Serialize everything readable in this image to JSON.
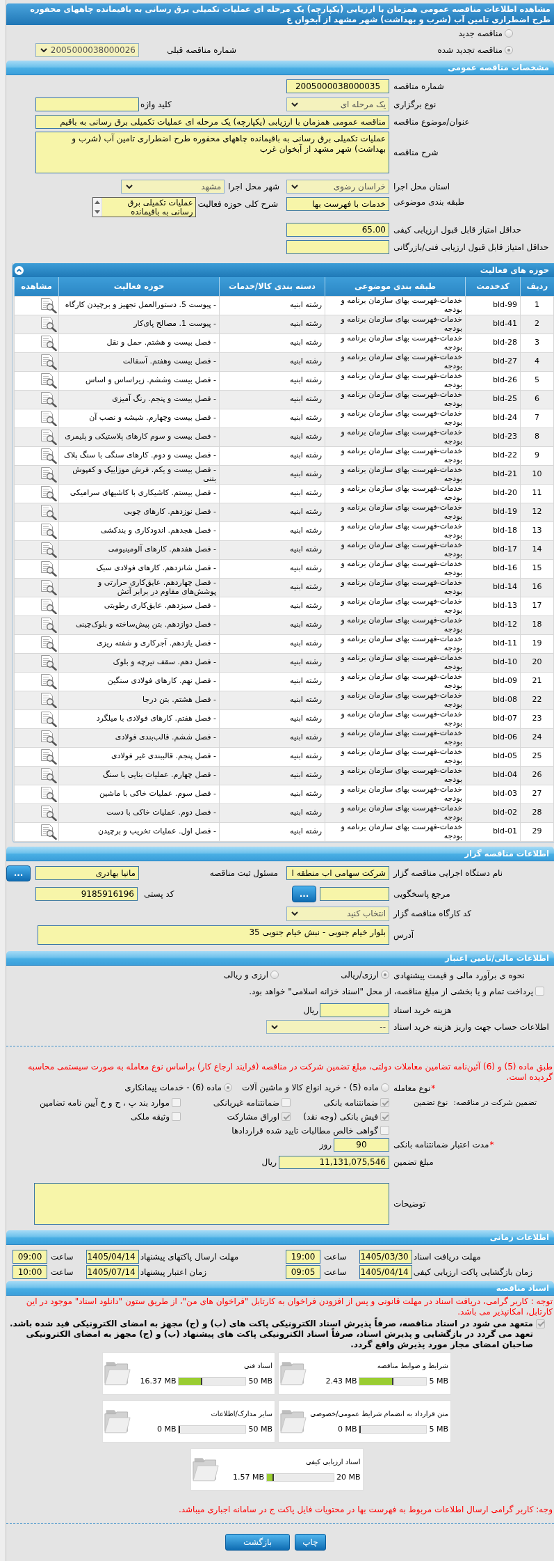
{
  "title": "مشاهده اطلاعات مناقصه عمومی همزمان با ارزیابی (یکپارچه) یک مرحله ای عملیات تکمیلی برق رسانی به باقیمانده چاههای محفوره طرح اضطراری تامین آب (شرب و بهداشت) شهر مشهد از آبخوان غ",
  "tender_kind": {
    "options": [
      {
        "label": "مناقصه جدید",
        "selected": false
      },
      {
        "label": "مناقصه تجدید شده",
        "selected": true
      }
    ],
    "previous_number": {
      "label": "شماره مناقصه قبلی",
      "value": "2005000038000026"
    }
  },
  "general": {
    "title": "مشخصات مناقصه عمومی",
    "tender_number": {
      "label": "شماره مناقصه",
      "value": "2005000038000035"
    },
    "holding_type": {
      "label": "نوع برگزاری",
      "value": "یک مرحله ای"
    },
    "keyword": {
      "label": "کلید واژه"
    },
    "subject": {
      "label": "عنوان/موضوع مناقصه",
      "value": "مناقصه عمومی همزمان با ارزیابی (یکپارچه) یک مرحله ای عملیات تکمیلی برق رسانی به باقیم"
    },
    "description": {
      "label": "شرح مناقصه",
      "value": "عملیات تکمیلی برق رسانی به باقیمانده چاههای محفوره طرح اضطراری تامین آب (شرب و بهداشت) شهر مشهد از آبخوان غرب"
    },
    "province": {
      "label": "استان محل اجرا",
      "value": "خراسان رضوی"
    },
    "city": {
      "label": "شهر محل اجرا",
      "value": "مشهد"
    },
    "classification": {
      "label": "طبقه بندی موضوعی",
      "value": "خدمات با فهرست بها"
    },
    "activity_summary": {
      "label": "شرح کلی حوزه فعالیت",
      "value": "عملیات تکمیلی برق رسانی به باقیمانده"
    },
    "min_quality_score": {
      "label": "حداقل امتیاز قابل قبول ارزیابی کیفی",
      "value": "65.00"
    },
    "min_technical_score": {
      "label": "حداقل امتیاز قابل قبول ارزیابی فنی/بازرگانی"
    }
  },
  "activities": {
    "title": "حوزه های فعالیت",
    "columns": [
      "ردیف",
      "کدخدمت",
      "طبقه بندی موضوعی",
      "دسته بندی کالا/خدمات",
      "حوزه فعالیت",
      "مشاهده"
    ],
    "rows": [
      {
        "row": "1",
        "code": "bld-99",
        "classification": "خدمات-فهرست بهای سازمان برنامه و بودجه",
        "category": "رشته ابنیه",
        "activity": "- پیوست 5. دستورالعمل تجهیز و برچیدن کارگاه"
      },
      {
        "row": "2",
        "code": "bld-41",
        "classification": "خدمات-فهرست بهای سازمان برنامه و بودجه",
        "category": "رشته ابنیه",
        "activity": "- پیوست 1. مصالح پای‌کار"
      },
      {
        "row": "3",
        "code": "bld-28",
        "classification": "خدمات-فهرست بهای سازمان برنامه و بودجه",
        "category": "رشته ابنیه",
        "activity": "- فصل بیست و هشتم. حمل و نقل"
      },
      {
        "row": "4",
        "code": "bld-27",
        "classification": "خدمات-فهرست بهای سازمان برنامه و بودجه",
        "category": "رشته ابنیه",
        "activity": "- فصل بیست وهفتم. آسفالت"
      },
      {
        "row": "5",
        "code": "bld-26",
        "classification": "خدمات-فهرست بهای سازمان برنامه و بودجه",
        "category": "رشته ابنیه",
        "activity": "- فصل بیست وششم. زیراساس و اساس"
      },
      {
        "row": "6",
        "code": "bld-25",
        "classification": "خدمات-فهرست بهای سازمان برنامه و بودجه",
        "category": "رشته ابنیه",
        "activity": "- فصل بیست و پنجم. رنگ آمیزی"
      },
      {
        "row": "7",
        "code": "bld-24",
        "classification": "خدمات-فهرست بهای سازمان برنامه و بودجه",
        "category": "رشته ابنیه",
        "activity": "- فصل بیست وچهارم. شیشه و نصب آن"
      },
      {
        "row": "8",
        "code": "bld-23",
        "classification": "خدمات-فهرست بهای سازمان برنامه و بودجه",
        "category": "رشته ابنیه",
        "activity": "- فصل بیست و سوم کارهای پلاستیکی و پلیمری"
      },
      {
        "row": "9",
        "code": "bld-22",
        "classification": "خدمات-فهرست بهای سازمان برنامه و بودجه",
        "category": "رشته ابنیه",
        "activity": "- فصل بیست و دوم. کارهای سنگی با سنگ پلاک"
      },
      {
        "row": "10",
        "code": "bld-21",
        "classification": "خدمات-فهرست بهای سازمان برنامه و بودجه",
        "category": "رشته ابنیه",
        "activity": "- فصل بیست و یکم. فرش موزاییک و کفپوش بتنی"
      },
      {
        "row": "11",
        "code": "bld-20",
        "classification": "خدمات-فهرست بهای سازمان برنامه و بودجه",
        "category": "رشته ابنیه",
        "activity": "- فصل بیستم. کاشیکاری با کاشیهای سرامیکی"
      },
      {
        "row": "12",
        "code": "bld-19",
        "classification": "خدمات-فهرست بهای سازمان برنامه و بودجه",
        "category": "رشته ابنیه",
        "activity": "- فصل نوزدهم. کارهای چوبی"
      },
      {
        "row": "13",
        "code": "bld-18",
        "classification": "خدمات-فهرست بهای سازمان برنامه و بودجه",
        "category": "رشته ابنیه",
        "activity": "- فصل هجدهم. اندودکاری و بندکشی"
      },
      {
        "row": "14",
        "code": "bld-17",
        "classification": "خدمات-فهرست بهای سازمان برنامه و بودجه",
        "category": "رشته ابنیه",
        "activity": "- فصل هفدهم. کارهای آلومینیومی"
      },
      {
        "row": "15",
        "code": "bld-16",
        "classification": "خدمات-فهرست بهای سازمان برنامه و بودجه",
        "category": "رشته ابنیه",
        "activity": "- فصل شانزدهم. کارهای فولادی سبک"
      },
      {
        "row": "16",
        "code": "bld-14",
        "classification": "خدمات-فهرست بهای سازمان برنامه و بودجه",
        "category": "رشته ابنیه",
        "activity": "- فصل چهاردهم. عایق‌کاری حرارتی و پوشش‌های مقاوم در برابر آتش"
      },
      {
        "row": "17",
        "code": "bld-13",
        "classification": "خدمات-فهرست بهای سازمان برنامه و بودجه",
        "category": "رشته ابنیه",
        "activity": "- فصل سیزدهم. عایق‌کاری رطوبتی"
      },
      {
        "row": "18",
        "code": "bld-12",
        "classification": "خدمات-فهرست بهای سازمان برنامه و بودجه",
        "category": "رشته ابنیه",
        "activity": "- فصل دوازدهم. بتن پیش‌ساخته و بلوک‌چینی"
      },
      {
        "row": "19",
        "code": "bld-11",
        "classification": "خدمات-فهرست بهای سازمان برنامه و بودجه",
        "category": "رشته ابنیه",
        "activity": "- فصل یازدهم. آجرکاری و شفته ریزی"
      },
      {
        "row": "20",
        "code": "bld-10",
        "classification": "خدمات-فهرست بهای سازمان برنامه و بودجه",
        "category": "رشته ابنیه",
        "activity": "- فصل دهم. سقف تیرچه و بلوک"
      },
      {
        "row": "21",
        "code": "bld-09",
        "classification": "خدمات-فهرست بهای سازمان برنامه و بودجه",
        "category": "رشته ابنیه",
        "activity": "- فصل نهم. کارهای فولادی سنگین"
      },
      {
        "row": "22",
        "code": "bld-08",
        "classification": "خدمات-فهرست بهای سازمان برنامه و بودجه",
        "category": "رشته ابنیه",
        "activity": "- فصل هشتم. بتن درجا"
      },
      {
        "row": "23",
        "code": "bld-07",
        "classification": "خدمات-فهرست بهای سازمان برنامه و بودجه",
        "category": "رشته ابنیه",
        "activity": "- فصل هفتم. کارهای فولادی با میلگرد"
      },
      {
        "row": "24",
        "code": "bld-06",
        "classification": "خدمات-فهرست بهای سازمان برنامه و بودجه",
        "category": "رشته ابنیه",
        "activity": "- فصل ششم. قالب‌بندی فولادی"
      },
      {
        "row": "25",
        "code": "bld-05",
        "classification": "خدمات-فهرست بهای سازمان برنامه و بودجه",
        "category": "رشته ابنیه",
        "activity": "- فصل پنجم. قالببندی غیر فولادی"
      },
      {
        "row": "26",
        "code": "bld-04",
        "classification": "خدمات-فهرست بهای سازمان برنامه و بودجه",
        "category": "رشته ابنیه",
        "activity": "- فصل چهارم. عملیات بنایی با سنگ"
      },
      {
        "row": "27",
        "code": "bld-03",
        "classification": "خدمات-فهرست بهای سازمان برنامه و بودجه",
        "category": "رشته ابنیه",
        "activity": "- فصل سوم. عملیات خاکی با ماشین"
      },
      {
        "row": "28",
        "code": "bld-02",
        "classification": "خدمات-فهرست بهای سازمان برنامه و بودجه",
        "category": "رشته ابنیه",
        "activity": "- فصل دوم. عملیات خاکی با دست"
      },
      {
        "row": "29",
        "code": "bld-01",
        "classification": "خدمات-فهرست بهای سازمان برنامه و بودجه",
        "category": "رشته ابنیه",
        "activity": "- فصل اول. عملیات تخریب و برچیدن"
      }
    ]
  },
  "organizer": {
    "title": "اطلاعات مناقصه گزار",
    "agency": {
      "label": "نام دستگاه اجرایی مناقصه گزار",
      "value": "شرکت سهامی اب منطقه ا"
    },
    "registrar": {
      "label": "مسئول ثبت مناقصه",
      "value": "مانیا بهادری",
      "button": "..."
    },
    "reference": {
      "label": "مرجع پاسخگویی",
      "button": "..."
    },
    "postal_code": {
      "label": "کد پستی",
      "value": "9185916196"
    },
    "workshop_code": {
      "label": "کد کارگاه مناقصه گزار",
      "value": "انتخاب کنید"
    },
    "address": {
      "label": "آدرس",
      "value": "بلوار خیام جنوبی - نبش خیام جنوبی 35"
    }
  },
  "finance": {
    "title": "اطلاعات مالی/تامین اعتبار",
    "estimate": {
      "label": "نحوه ی برآورد مالی و قیمت پیشنهادی",
      "options": [
        {
          "label": "ارزی/ریالی",
          "selected": true
        },
        {
          "label": "ارزی و ریالی",
          "selected": false
        }
      ]
    },
    "treasury": {
      "label": "پرداخت تمام و یا بخشی از مبلغ مناقصه، از محل \"اسناد خزانه اسلامی\" خواهد بود.",
      "checked": false
    },
    "document_fee": {
      "label": "هزینه خرید اسناد",
      "unit": "ریال"
    },
    "account": {
      "label": "اطلاعات حساب جهت واریز هزینه خرید اسناد",
      "value": "--"
    }
  },
  "guarantee": {
    "notice": "طبق ماده (5) و (6) آئین‌نامه تضامین معاملات دولتی، مبلغ تضمین شرکت در مناقصه (فرایند ارجاع کار) براساس نوع معامله به صورت سیستمی محاسبه گردیده است.",
    "deal_type": {
      "mark": "*",
      "label": "نوع معامله",
      "options": [
        {
          "label": "ماده (5) - خرید انواع کالا و ماشین آلات",
          "selected": false
        },
        {
          "label": "ماده (6) - خدمات پیمانکاری",
          "selected": true
        }
      ]
    },
    "participation_label": "تضمین شرکت در مناقصه:",
    "type_label": "نوع تضمین",
    "types": [
      {
        "label": "ضمانتنامه بانکی",
        "checked": true
      },
      {
        "label": "ضمانتنامه غیربانکی",
        "checked": false
      },
      {
        "label": "موارد بند پ ، ح و خ آیین نامه تضامین",
        "checked": false
      },
      {
        "label": "فیش بانکی (وجه نقد)",
        "checked": true
      },
      {
        "label": "اوراق مشارکت",
        "checked": true
      },
      {
        "label": "وثیقه ملکی",
        "checked": false
      },
      {
        "label": "گواهی خالص مطالبات تایید شده قراردادها",
        "checked": false
      }
    ],
    "validity": {
      "mark": "*",
      "label": "مدت اعتبار ضمانتنامه بانکی",
      "value": "90",
      "unit": "روز"
    },
    "amount": {
      "label": "مبلغ تضمین",
      "value": "11,131,075,546",
      "unit": "ریال"
    },
    "notes": {
      "label": "توضیحات"
    }
  },
  "schedule": {
    "title": "اطلاعات زمانی",
    "items": [
      {
        "label": "مهلت دریافت اسناد",
        "date": "1405/03/30",
        "time_label": "ساعت",
        "time": "19:00"
      },
      {
        "label": "مهلت ارسال پاکتهای پیشنهاد",
        "date": "1405/04/14",
        "time_label": "ساعت",
        "time": "09:00"
      },
      {
        "label": "زمان بازگشایی پاکت ارزیابی کیفی",
        "date": "1405/04/14",
        "time_label": "ساعت",
        "time": "09:05"
      },
      {
        "label": "زمان اعتبار پیشنهاد",
        "date": "1405/07/14",
        "time_label": "ساعت",
        "time": "10:00"
      }
    ]
  },
  "documents": {
    "title": "اسناد مناقصه",
    "notice": "توجه : کاربر گرامی، دریافت اسناد در مهلت قانونی و پس از افزودن فراخوان به کارتابل \"فراخوان های من\"، از طریق ستون \"دانلود اسناد\" موجود در این کارتابل، امکانپذیر می باشد.",
    "commitment": {
      "checked": true,
      "text": "متعهد می شود در اسناد مناقصه، صرفاً پذیرش اسناد الکترونیکی پاکت های (ب) و (ج) مجهز به امضای الکترونیکی قید شده باشد. تعهد می گردد در بازگشایی و پذیرش اسناد، صرفاً اسناد الکترونیکی پاکت های پیشنهاد (ب) و (ج) مجهز به امضای الکترونیکی صاحبان امضای مجاز مورد پذیرش واقع گردد."
    },
    "files": [
      {
        "name": "شرایط و ضوابط مناقصه",
        "capacity": "5 MB",
        "size": "2.43 MB",
        "level": 0.49
      },
      {
        "name": "اسناد فنی",
        "capacity": "50 MB",
        "size": "16.37 MB",
        "level": 0.33
      },
      {
        "name": "متن قرارداد به انضمام شرایط عمومی/خصوصی",
        "capacity": "5 MB",
        "size": "0 MB",
        "level": 0
      },
      {
        "name": "سایر مدارک/اطلاعات",
        "capacity": "50 MB",
        "size": "0 MB",
        "level": 0
      },
      {
        "name": "اسناد ارزیابی کیفی",
        "capacity": "20 MB",
        "size": "1.57 MB",
        "level": 0.08
      }
    ],
    "footer_note": "وجه: کاربر گرامی ارسال اطلاعات مربوط به فهرست بها در محتویات فایل پاکت ج در سامانه اجباری میباشد."
  },
  "buttons": [
    "چاپ",
    "بازگشت"
  ]
}
